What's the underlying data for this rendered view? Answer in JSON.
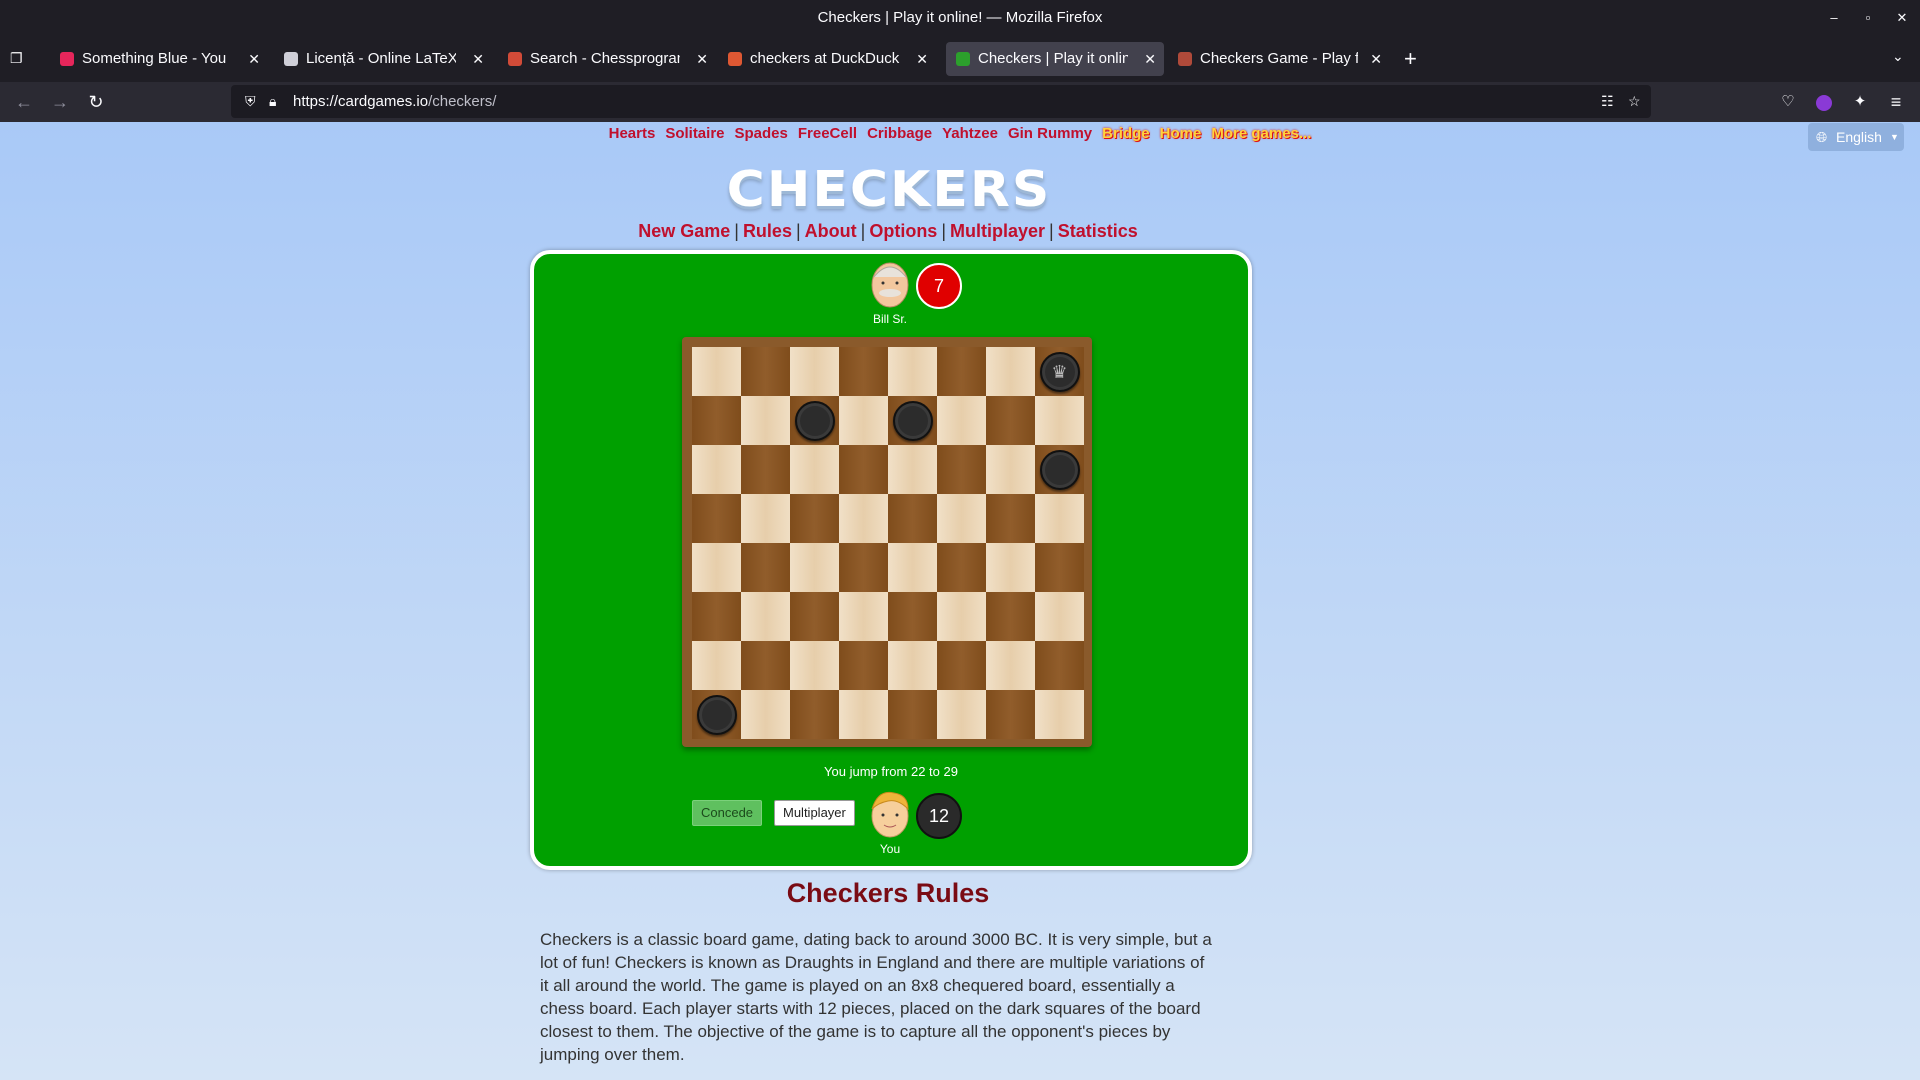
{
  "browser": {
    "window_title": "Checkers | Play it online! — Mozilla Firefox",
    "tabs": [
      {
        "label": "Something Blue - You",
        "color": "#e6265b",
        "active": false
      },
      {
        "label": "Licență - Online LaTeX Ed",
        "color": "#cfcfd8",
        "active": false
      },
      {
        "label": "Search - Chessprogramm",
        "color": "#d14b38",
        "active": false
      },
      {
        "label": "checkers at DuckDuckGo",
        "color": "#de5833",
        "active": false
      },
      {
        "label": "Checkers | Play it online!",
        "color": "#2ca02c",
        "active": true
      },
      {
        "label": "Checkers Game - Play for",
        "color": "#b04a3a",
        "active": false
      }
    ],
    "url_host": "https://cardgames.io",
    "url_path": "/checkers/"
  },
  "topnav": [
    "Hearts",
    "Solitaire",
    "Spades",
    "FreeCell",
    "Cribbage",
    "Yahtzee",
    "Gin Rummy"
  ],
  "topnav_highlight": [
    "Bridge",
    "Home",
    "More games..."
  ],
  "language": "English",
  "logo": "CHECKERS",
  "menu": [
    "New Game",
    "Rules",
    "About",
    "Options",
    "Multiplayer",
    "Statistics"
  ],
  "game": {
    "opponent": {
      "name": "Bill Sr.",
      "score": "7",
      "color": "#e00000"
    },
    "player": {
      "name": "You",
      "score": "12",
      "color": "#2a2a2a"
    },
    "status": "You jump from 22 to 29",
    "buttons": {
      "concede": "Concede",
      "multiplayer": "Multiplayer"
    },
    "pieces": [
      {
        "row": 0,
        "col": 7,
        "king": true
      },
      {
        "row": 1,
        "col": 2,
        "king": false
      },
      {
        "row": 1,
        "col": 4,
        "king": false
      },
      {
        "row": 2,
        "col": 7,
        "king": false
      },
      {
        "row": 7,
        "col": 0,
        "king": false
      }
    ]
  },
  "rules": {
    "heading": "Checkers Rules",
    "text": "Checkers is a classic board game, dating back to around 3000 BC. It is very simple, but a lot of fun! Checkers is known as Draughts in England and there are multiple variations of it all around the world. The game is played on an 8x8 chequered board, essentially a chess board. Each player starts with 12 pieces, placed on the dark squares of the board closest to them. The objective of the game is to capture all the opponent's pieces by jumping over them."
  }
}
